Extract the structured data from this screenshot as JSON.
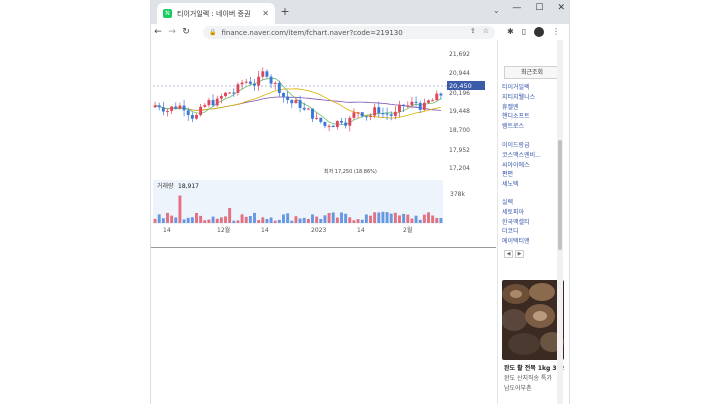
{
  "browser": {
    "tab_title": "티이거일렉 : 네이버 증권",
    "new_tab": "+",
    "url": "finance.naver.com/item/fchart.naver?code=219130",
    "window_controls": [
      "—",
      "☐",
      "✕"
    ]
  },
  "chart": {
    "price_labels": [
      "21,692",
      "20,944",
      "20,450",
      "20,196",
      "19,448",
      "18,700",
      "17,952",
      "17,204"
    ],
    "current_price": "20,450",
    "low_annotation": "최저 17,250 (18.86%)",
    "volume_label": "거래량",
    "volume_value": "18,917",
    "volume_axis": "378k",
    "x_labels": [
      "14",
      "12월",
      "14",
      "2023",
      "14",
      "2월"
    ],
    "colors": {
      "up": "#e0465a",
      "down": "#3a78d8",
      "ma_long": "#7a4fb3",
      "ma_mid": "#d9b100",
      "ma_short": "#6ec06e",
      "price_tag": "#3b5aa8"
    }
  },
  "sidebar": {
    "title": "최근조회",
    "group1": [
      "티이거일렉",
      "지티지웰니스",
      "휴젤엔",
      "핸디소프트",
      "렘트로스"
    ],
    "group2": [
      "이이드랑급",
      "코스맥스엔비...",
      "씨아이에스",
      "편편",
      "세노텍"
    ],
    "group3": [
      "실렉",
      "세토피아",
      "한국액셀티",
      "더코디",
      "에이텍티앤"
    ],
    "prev": "◀",
    "next": "▶"
  },
  "ad": {
    "line1": "완도 활 전복 1kg 37,9",
    "line2": "완도 산지직송 특가",
    "line3": "남도어부촌"
  }
}
